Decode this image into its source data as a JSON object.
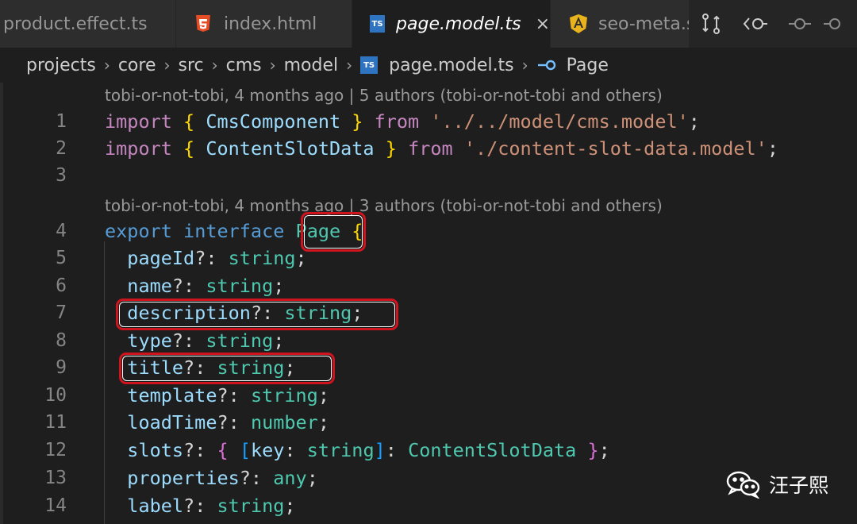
{
  "tabs": [
    {
      "label": "product.effect.ts",
      "icon": "typescript-icon"
    },
    {
      "label": "index.html",
      "icon": "html5-icon"
    },
    {
      "label": "page.model.ts",
      "icon": "typescript-icon",
      "active": true,
      "close": "×"
    },
    {
      "label": "seo-meta.s",
      "icon": "angular-icon"
    }
  ],
  "ts_badge": "TS",
  "breadcrumb": {
    "items": [
      "projects",
      "core",
      "src",
      "cms",
      "model",
      "page.model.ts",
      "Page"
    ],
    "separator": "›"
  },
  "codelens": [
    "tobi-or-not-tobi, 4 months ago | 5 authors (tobi-or-not-tobi and others)",
    "tobi-or-not-tobi, 4 months ago | 3 authors (tobi-or-not-tobi and others)"
  ],
  "line_numbers": [
    "1",
    "2",
    "3",
    "4",
    "5",
    "6",
    "7",
    "8",
    "9",
    "10",
    "11",
    "12",
    "13",
    "14"
  ],
  "code": {
    "l1": {
      "import": "import",
      "b1": "{",
      "name": "CmsComponent",
      "b2": "}",
      "from": "from",
      "path": "'../../model/cms.model'",
      "semi": ";"
    },
    "l2": {
      "import": "import",
      "b1": "{",
      "name": "ContentSlotData",
      "b2": "}",
      "from": "from",
      "path": "'./content-slot-data.model'",
      "semi": ";"
    },
    "l4": {
      "export": "export",
      "interface": "interface",
      "name": "Page",
      "brace": "{"
    },
    "fields": [
      {
        "name": "pageId",
        "opt": "?: ",
        "type": "string",
        "semi": ";"
      },
      {
        "name": "name",
        "opt": "?: ",
        "type": "string",
        "semi": ";"
      },
      {
        "name": "description",
        "opt": "?: ",
        "type": "string",
        "semi": ";"
      },
      {
        "name": "type",
        "opt": "?: ",
        "type": "string",
        "semi": ";"
      },
      {
        "name": "title",
        "opt": "?: ",
        "type": "string",
        "semi": ";"
      },
      {
        "name": "template",
        "opt": "?: ",
        "type": "string",
        "semi": ";"
      },
      {
        "name": "loadTime",
        "opt": "?: ",
        "type": "number",
        "semi": ";"
      }
    ],
    "l12": {
      "name": "slots",
      "opt": "?: ",
      "b1": "{",
      "b2": "[",
      "key": "key",
      "colon": ": ",
      "ktype": "string",
      "b3": "]",
      "colon2": ": ",
      "type": "ContentSlotData",
      "b4": "}",
      "semi": ";"
    },
    "l13": {
      "name": "properties",
      "opt": "?: ",
      "type": "any",
      "semi": ";"
    },
    "l14": {
      "name": "label",
      "opt": "?: ",
      "type": "string",
      "semi": ";"
    }
  },
  "watermark": {
    "text": "汪子熙",
    "icon": "wechat-icon"
  },
  "colors": {
    "highlight": "#d0141e",
    "keyword": "#c586c0",
    "type": "#4ec9b0",
    "string": "#ce9178",
    "property": "#9cdcfe"
  }
}
